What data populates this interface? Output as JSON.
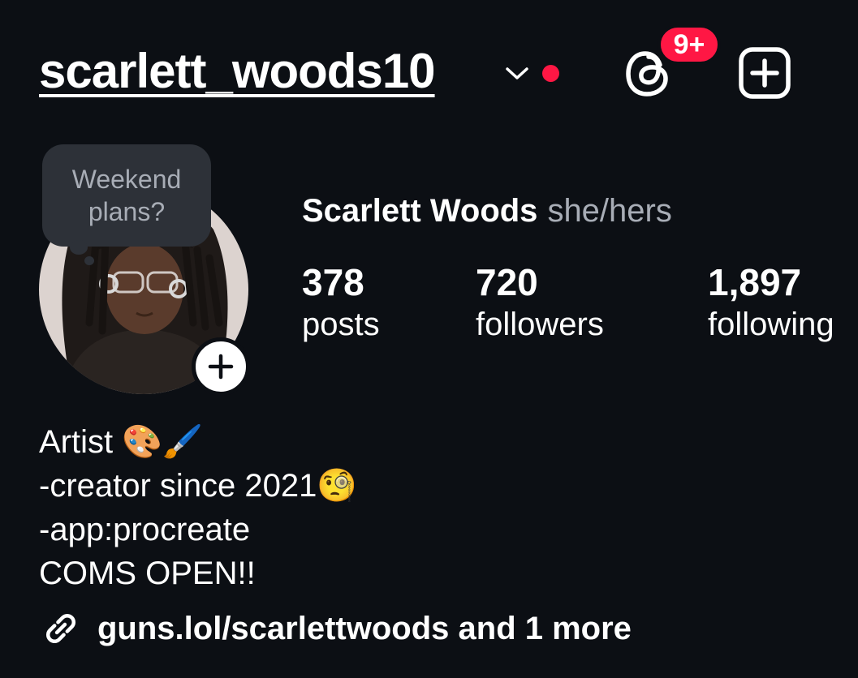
{
  "header": {
    "username": "scarlett_woods10",
    "threads_badge": "9+"
  },
  "note": {
    "line1": "Weekend",
    "line2": "plans?"
  },
  "profile": {
    "full_name": "Scarlett Woods",
    "pronouns": "she/hers"
  },
  "stats": [
    {
      "value": "378",
      "label": "posts"
    },
    {
      "value": "720",
      "label": "followers"
    },
    {
      "value": "1,897",
      "label": "following"
    }
  ],
  "bio": {
    "lines": [
      "Artist 🎨🖌️",
      "-creator since 2021🧐",
      "-app:procreate",
      "COMS OPEN!!"
    ]
  },
  "link": {
    "text": "guns.lol/scarlettwoods and 1 more"
  },
  "icons": {
    "dropdown": "chevron-down-icon",
    "live": "live-dot-icon",
    "threads": "threads-icon",
    "create": "plus-square-icon",
    "add_story": "plus-icon",
    "link": "link-icon"
  },
  "colors": {
    "background": "#0c0f14",
    "badge": "#ff1744",
    "secondary_text": "#a8adb6"
  }
}
